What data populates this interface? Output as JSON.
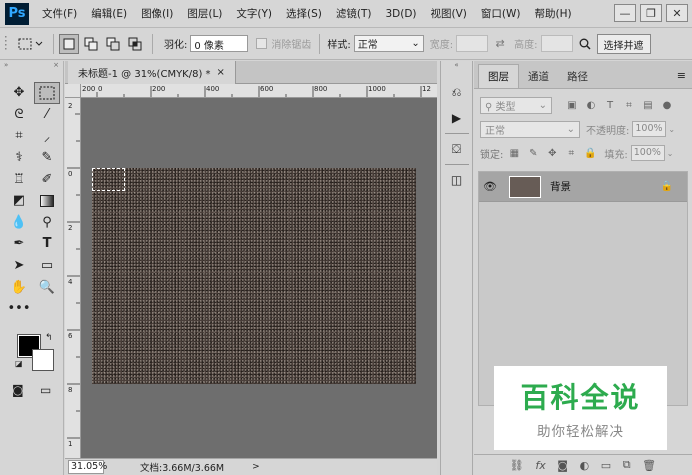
{
  "app": {
    "logo": "Ps"
  },
  "menu": [
    "文件(F)",
    "编辑(E)",
    "图像(I)",
    "图层(L)",
    "文字(Y)",
    "选择(S)",
    "滤镜(T)",
    "3D(D)",
    "视图(V)",
    "窗口(W)",
    "帮助(H)"
  ],
  "window_controls": {
    "minimize": "—",
    "restore": "❐",
    "close": "✕"
  },
  "options": {
    "feather_label": "羽化:",
    "feather_value": "0 像素",
    "antialias_label": "消除锯齿",
    "style_label": "样式:",
    "style_value": "正常",
    "width_label": "宽度:",
    "height_label": "高度:",
    "select_mask_button": "选择并遮"
  },
  "document": {
    "tab_title": "未标题-1 @ 31%(CMYK/8) *",
    "tab_close": "×",
    "ruler_top": [
      "200",
      "0",
      "200",
      "400",
      "600",
      "800",
      "1000",
      "12"
    ],
    "ruler_left": [
      "2",
      "0",
      "2",
      "4",
      "6",
      "8",
      "1"
    ],
    "zoom": "31.05%",
    "doc_info": "文档:3.66M/3.66M",
    "status_arrow": ">"
  },
  "layers_panel": {
    "tabs": [
      "图层",
      "通道",
      "路径"
    ],
    "menu_icon": "≡",
    "filter_type": "类型",
    "blend_mode": "正常",
    "opacity_label": "不透明度:",
    "opacity_value": "100%",
    "lock_label": "锁定:",
    "fill_label": "填充:",
    "fill_value": "100%",
    "layers": [
      {
        "name": "背景",
        "visible": true,
        "locked": true
      }
    ],
    "footer_icons": [
      "link-icon",
      "fx-icon",
      "mask-icon",
      "adjustment-icon",
      "group-icon",
      "new-layer-icon",
      "delete-icon"
    ]
  },
  "watermark": {
    "title": "百科全说",
    "subtitle": "助你轻松解决"
  },
  "colors": {
    "foreground": "#000000",
    "background": "#ffffff",
    "watermark_green": "#2dab4e"
  }
}
